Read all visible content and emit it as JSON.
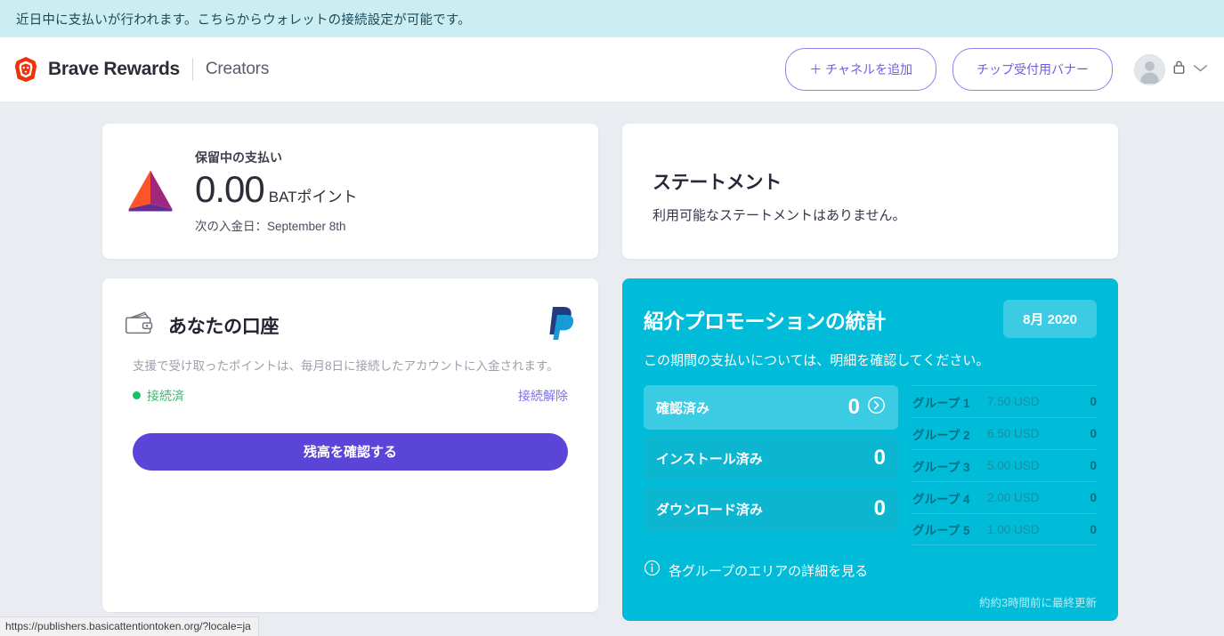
{
  "banner": {
    "message": "近日中に支払いが行われます。こちらからウォレットの接続設定が可能です。"
  },
  "header": {
    "brand_name": "Brave Rewards",
    "brand_sub": "Creators",
    "add_channel_label": "＋ チャネルを追加",
    "tip_banner_label": "チップ受付用バナー",
    "icons": {
      "logo": "brave-lion-icon",
      "avatar": "user-avatar-icon",
      "lock": "lock-icon",
      "chevron": "chevron-down-icon"
    }
  },
  "payout_card": {
    "label": "保留中の支払い",
    "amount": "0.00",
    "unit": "BATポイント",
    "next_deposit": "次の入金日：September 8th",
    "logo_colors": {
      "left": "#fb542b",
      "right": "#a1277e",
      "bottom": "#662d91"
    }
  },
  "statement_card": {
    "title": "ステートメント",
    "empty_text": "利用可能なステートメントはありません。"
  },
  "account_card": {
    "title": "あなたの口座",
    "wallet_icon": "wallet-icon",
    "provider_icon": "paypal-logo-icon",
    "description": "支援で受け取ったポイントは、毎月8日に接続したアカウントに入金されます。",
    "status_text": "接続済",
    "status_color": "#33bb6c",
    "disconnect_label": "接続解除",
    "balance_button_label": "残高を確認する",
    "balance_button_color": "#5b45d8"
  },
  "referral_panel": {
    "title": "紹介プロモーションの統計",
    "month_badge": "8月 2020",
    "subtitle": "この期間の支払いについては、明細を確認してください。",
    "background_color": "#00bcd8",
    "stats": [
      {
        "label": "確認済み",
        "value": "0",
        "active": true,
        "has_chevron": true
      },
      {
        "label": "インストール済み",
        "value": "0",
        "active": false,
        "has_chevron": false
      },
      {
        "label": "ダウンロード済み",
        "value": "0",
        "active": false,
        "has_chevron": false
      }
    ],
    "groups": [
      {
        "name": "グループ 1",
        "amount": "7.50 USD",
        "count": "0"
      },
      {
        "name": "グループ 2",
        "amount": "6.50 USD",
        "count": "0"
      },
      {
        "name": "グループ 3",
        "amount": "5.00 USD",
        "count": "0"
      },
      {
        "name": "グループ 4",
        "amount": "2.00 USD",
        "count": "0"
      },
      {
        "name": "グループ 5",
        "amount": "1.00 USD",
        "count": "0"
      }
    ],
    "details_link": "各グループのエリアの詳細を見る",
    "details_icon": "info-icon",
    "last_updated": "約約3時間前に最終更新"
  },
  "status_bar": {
    "url": "https://publishers.basicattentiontoken.org/?locale=ja"
  }
}
